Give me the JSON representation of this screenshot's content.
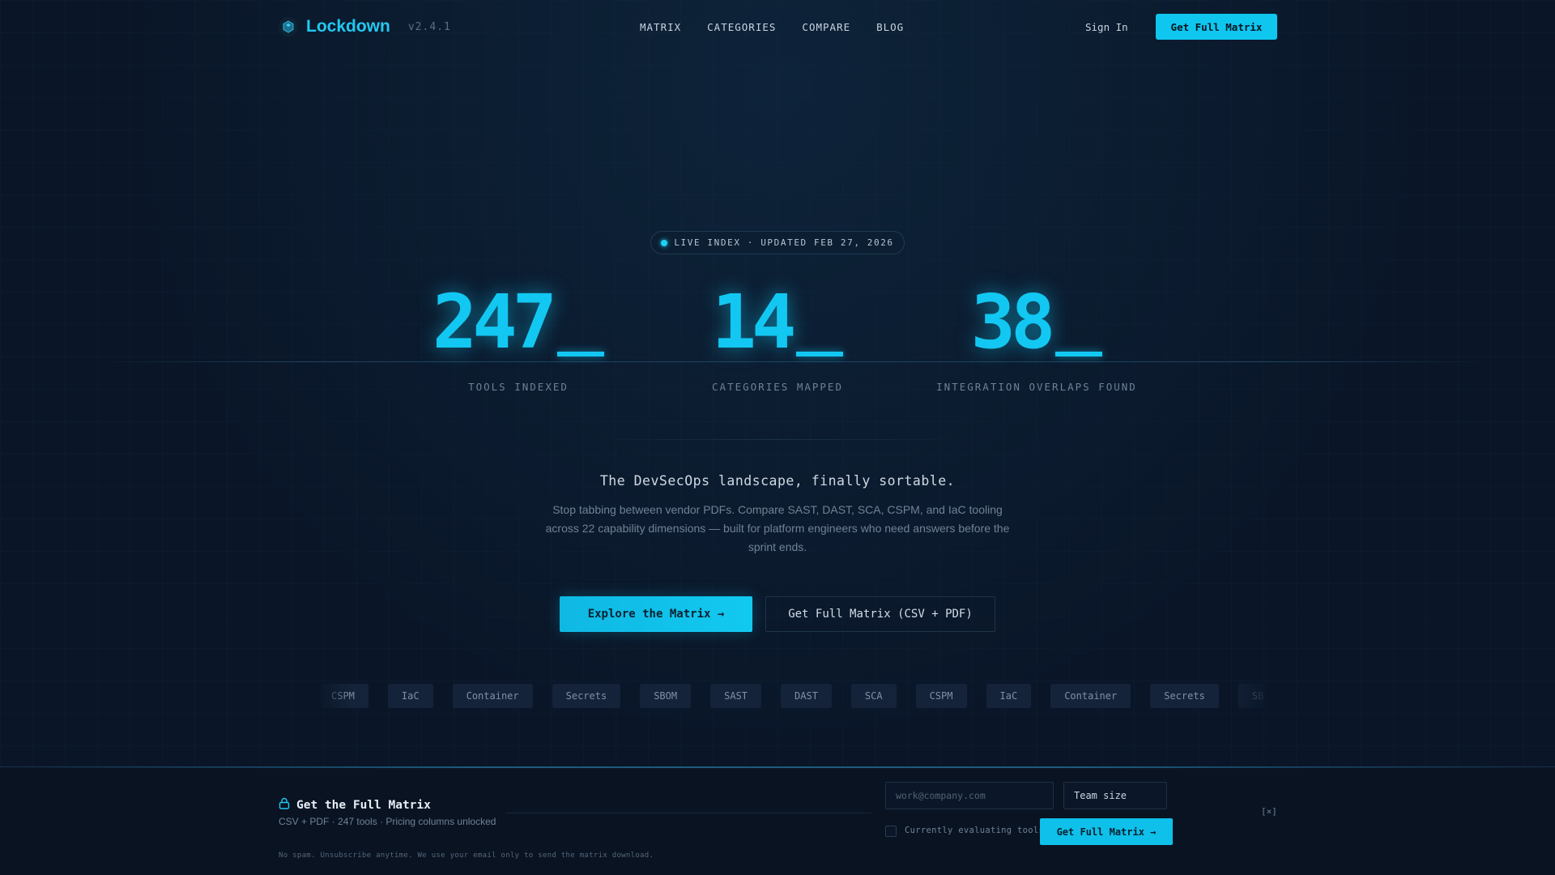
{
  "header": {
    "brand": "Lockdown",
    "version": "v2.4.1",
    "nav": [
      "MATRIX",
      "CATEGORIES",
      "COMPARE",
      "BLOG"
    ],
    "sign_in": "Sign In",
    "cta": "Get Full Matrix",
    "logo_icon": "hexagon-shield-icon"
  },
  "badge": {
    "text": "LIVE INDEX · UPDATED FEB 27, 2026"
  },
  "stats": [
    {
      "value": "247",
      "label": "TOOLS INDEXED"
    },
    {
      "value": "14",
      "label": "CATEGORIES MAPPED"
    },
    {
      "value": "38",
      "label": "INTEGRATION OVERLAPS FOUND"
    }
  ],
  "hero": {
    "tagline": "The DevSecOps landscape, finally sortable.",
    "description": "Stop tabbing between vendor PDFs. Compare SAST, DAST, SCA, CSPM, and IaC tooling across 22 capability dimensions — built for platform engineers who need answers before the sprint ends.",
    "primary_cta": "Explore the Matrix →",
    "secondary_cta": "Get Full Matrix (CSV + PDF)"
  },
  "chips": [
    "CSPM",
    "IaC",
    "Container",
    "Secrets",
    "SBOM",
    "SAST",
    "DAST",
    "SCA",
    "CSPM",
    "IaC",
    "Container",
    "Secrets",
    "SB"
  ],
  "capture": {
    "title": "Get the Full Matrix",
    "subtitle": "CSV + PDF · 247 tools · Pricing columns unlocked",
    "email_placeholder": "work@company.com",
    "team_size": "Team size",
    "checkbox_label": "Currently evaluating tools",
    "button": "Get Full Matrix →",
    "close": "[×]",
    "note": "No spam. Unsubscribe anytime. We use your email only to send the matrix download.",
    "lock_icon": "lock-icon"
  },
  "colors": {
    "background": "#0a1628",
    "accent": "#12c8f2"
  }
}
